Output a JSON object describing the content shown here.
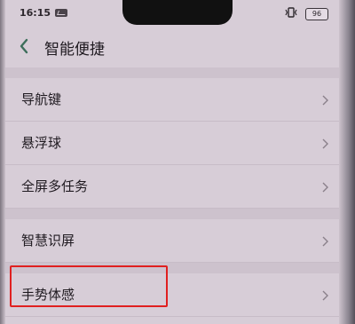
{
  "status_bar": {
    "time": "16:15",
    "battery": "96"
  },
  "header": {
    "title": "智能便捷"
  },
  "settings": {
    "items": [
      {
        "label": "导航键"
      },
      {
        "label": "悬浮球"
      },
      {
        "label": "全屏多任务"
      },
      {
        "label": "智慧识屏"
      },
      {
        "label": "手势体感"
      }
    ]
  },
  "colors": {
    "background": "#d7cdd7",
    "highlight": "#e02020"
  },
  "icons": {
    "back": "chevron-left-icon",
    "row_arrow": "chevron-right-icon",
    "message": "message-icon",
    "vibrate": "vibrate-icon",
    "battery": "battery-icon"
  }
}
